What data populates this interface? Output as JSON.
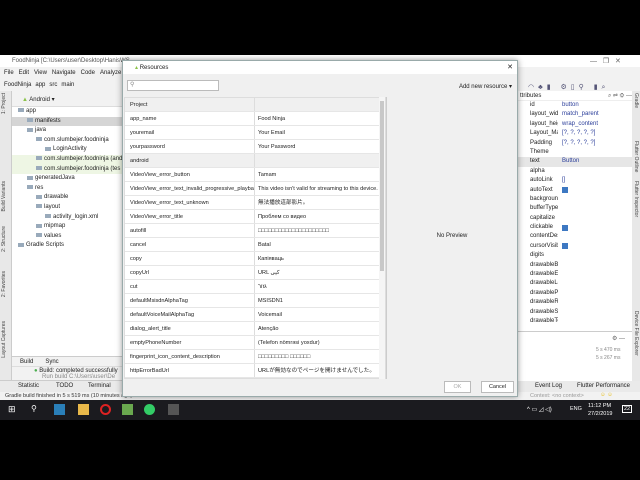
{
  "ide": {
    "title": "FoodNinja [C:\\Users\\user\\Desktop\\HanisWS",
    "menu": [
      "File",
      "Edit",
      "View",
      "Navigate",
      "Code",
      "Analyze"
    ],
    "breadcrumb": [
      "FoodNinja",
      "app",
      "src",
      "main"
    ],
    "project_view": "Android",
    "tree": [
      {
        "label": "app",
        "indent": 0,
        "cls": ""
      },
      {
        "label": "manifests",
        "indent": 1,
        "cls": "sel"
      },
      {
        "label": "java",
        "indent": 1,
        "cls": ""
      },
      {
        "label": "com.slumbejer.foodninja",
        "indent": 2,
        "cls": ""
      },
      {
        "label": "LoginActivity",
        "indent": 3,
        "cls": ""
      },
      {
        "label": "com.slumbejer.foodninja (and",
        "indent": 2,
        "cls": "grn"
      },
      {
        "label": "com.slumbejer.foodninja (tes",
        "indent": 2,
        "cls": "grn"
      },
      {
        "label": "generatedJava",
        "indent": 1,
        "cls": ""
      },
      {
        "label": "res",
        "indent": 1,
        "cls": ""
      },
      {
        "label": "drawable",
        "indent": 2,
        "cls": ""
      },
      {
        "label": "layout",
        "indent": 2,
        "cls": ""
      },
      {
        "label": "activity_login.xml",
        "indent": 3,
        "cls": ""
      },
      {
        "label": "mipmap",
        "indent": 2,
        "cls": ""
      },
      {
        "label": "values",
        "indent": 2,
        "cls": ""
      },
      {
        "label": "Gradle Scripts",
        "indent": 0,
        "cls": ""
      }
    ],
    "left_tabs": [
      "1: Project",
      "Build Variants",
      "2: Structure",
      "2: Favorites",
      "Layout Captures"
    ],
    "build_tabs": [
      "Build",
      "Sync"
    ],
    "build_lines": [
      "Build: completed successfully",
      "Run build C:\\Users\\user\\De"
    ],
    "bottom_tabs": [
      "Statistic",
      "TODO",
      "Terminal",
      "Event Log",
      "Flutter Performance"
    ],
    "status": "Gradle build finished in 5 s 519 ms (10 minutes ago)",
    "context": "Context: <no context>",
    "timings": [
      "5 s 470 ms",
      "5 s 267 ms"
    ],
    "attributes_title": "ttributes",
    "attributes": [
      {
        "k": "id",
        "v": "button"
      },
      {
        "k": "layout_width",
        "v": "match_parent"
      },
      {
        "k": "layout_height",
        "v": "wrap_content"
      },
      {
        "k": "Layout_Margin",
        "v": "[?, ?, ?, ?, ?]"
      },
      {
        "k": "Padding",
        "v": "[?, ?, ?, ?, ?]"
      },
      {
        "k": "Theme",
        "v": ""
      },
      {
        "k": "text",
        "v": "Button"
      },
      {
        "k": "alpha",
        "v": ""
      },
      {
        "k": "autoLink",
        "v": "[]"
      },
      {
        "k": "autoText",
        "v": "■"
      },
      {
        "k": "background",
        "v": ""
      },
      {
        "k": "bufferType",
        "v": ""
      },
      {
        "k": "capitalize",
        "v": ""
      },
      {
        "k": "clickable",
        "v": "■"
      },
      {
        "k": "contentDescrip",
        "v": ""
      },
      {
        "k": "cursorVisible",
        "v": "■"
      },
      {
        "k": "digits",
        "v": ""
      },
      {
        "k": "drawableBottom",
        "v": ""
      },
      {
        "k": "drawableEnd",
        "v": ""
      },
      {
        "k": "drawableLeft",
        "v": ""
      },
      {
        "k": "drawablePaddin",
        "v": ""
      },
      {
        "k": "drawableRight",
        "v": ""
      },
      {
        "k": "drawableStart",
        "v": ""
      },
      {
        "k": "drawableTop",
        "v": ""
      }
    ],
    "right_tabs": [
      "Gradle",
      "Flutter Outline",
      "Flutter Inspector",
      "Device File Explorer"
    ]
  },
  "dialog": {
    "title": "Resources",
    "search_placeholder": "",
    "add_new": "Add new resource ▾",
    "no_preview": "No Preview",
    "ok": "OK",
    "cancel": "Cancel",
    "rows": [
      {
        "k": "Project",
        "v": "",
        "grp": true
      },
      {
        "k": "app_name",
        "v": "Food Ninja"
      },
      {
        "k": "youremail",
        "v": "Your Email"
      },
      {
        "k": "yourpassword",
        "v": "Your Password"
      },
      {
        "k": "android",
        "v": "",
        "grp": true
      },
      {
        "k": "VideoView_error_button",
        "v": "Tamam"
      },
      {
        "k": "VideoView_error_text_invalid_progressive_playback",
        "v": "This video isn't valid for streaming to this device."
      },
      {
        "k": "VideoView_error_text_unknown",
        "v": "無法播放這部影片。"
      },
      {
        "k": "VideoView_error_title",
        "v": "Проблем со видео"
      },
      {
        "k": "autofill",
        "v": "□□□□□□□□□□□□□□□□□□□□□"
      },
      {
        "k": "cancel",
        "v": "Batal"
      },
      {
        "k": "copy",
        "v": "Капіяваць"
      },
      {
        "k": "copyUrl",
        "v": "URL کپی"
      },
      {
        "k": "cut",
        "v": "גזור"
      },
      {
        "k": "defaultMsisdnAlphaTag",
        "v": "MSISDN1"
      },
      {
        "k": "defaultVoiceMailAlphaTag",
        "v": "Voicemail"
      },
      {
        "k": "dialog_alert_title",
        "v": "Atenção"
      },
      {
        "k": "emptyPhoneNumber",
        "v": "(Telefon nömrəsi yoxdur)"
      },
      {
        "k": "fingerprint_icon_content_description",
        "v": "□□□□□□□□□ □□□□□□"
      },
      {
        "k": "httpErrorBadUrl",
        "v": "URLが無効なのでページを開けませんでした。"
      }
    ]
  },
  "taskbar": {
    "lang": "ENG",
    "time": "11:12 PM",
    "date": "27/2/2019",
    "notifications": "22"
  },
  "colors": {
    "accent": "#3d78c2",
    "link": "#2a3d9a"
  }
}
